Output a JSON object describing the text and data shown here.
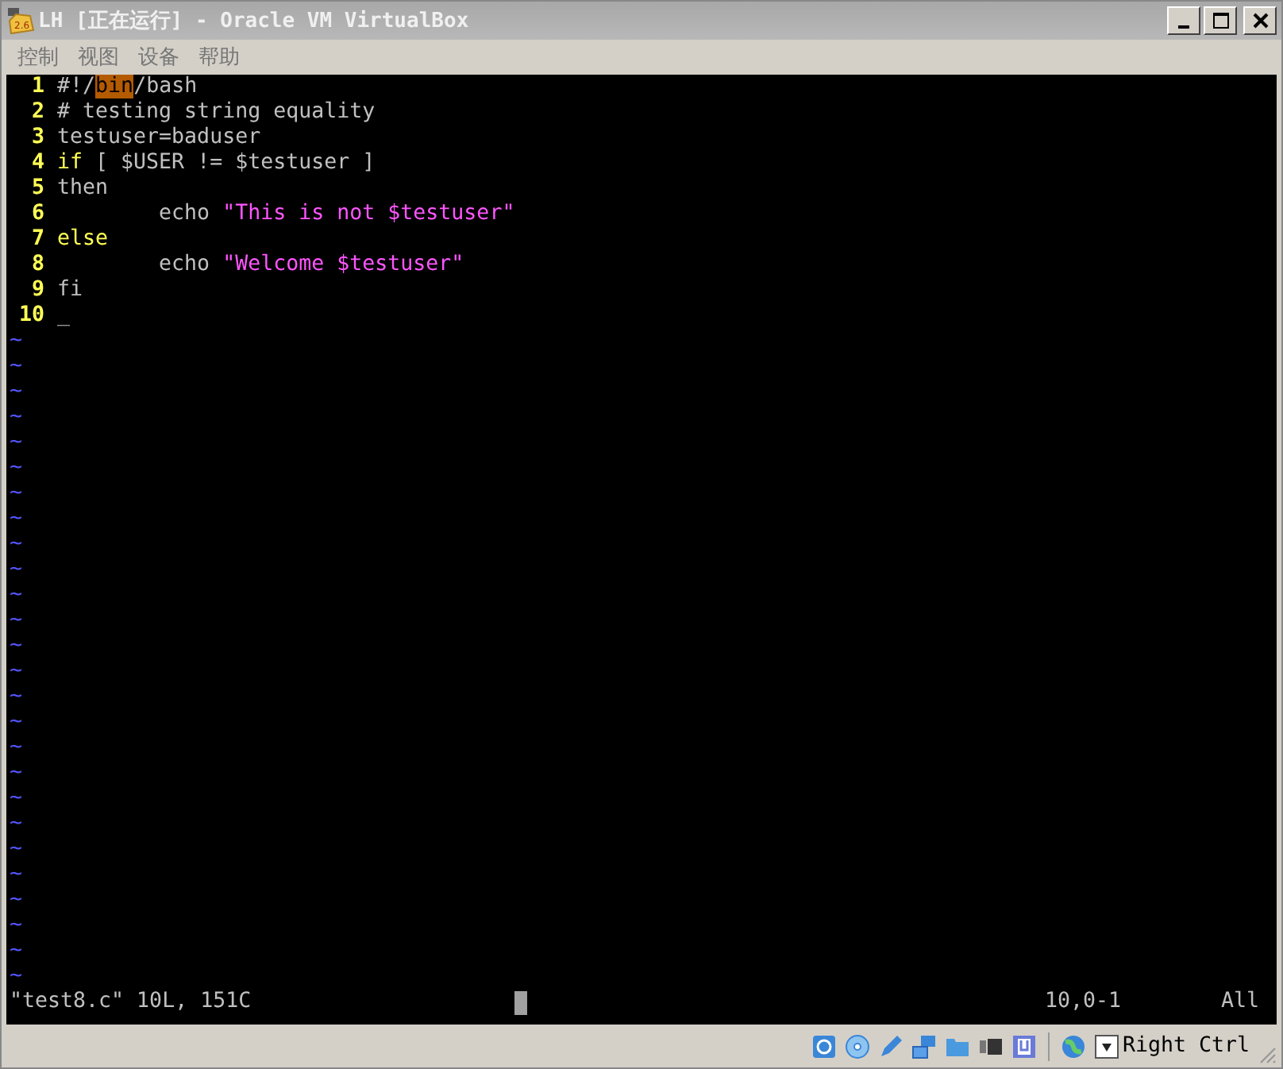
{
  "window": {
    "title": "LH [正在运行] - Oracle VM VirtualBox",
    "icon_label": "2.6"
  },
  "menu": [
    "控制",
    "视图",
    "设备",
    "帮助"
  ],
  "editor": {
    "lines": [
      {
        "number": "1",
        "segments": [
          {
            "text": "#!/",
            "kind": "normal"
          },
          {
            "text": "bin",
            "kind": "highlight"
          },
          {
            "text": "/bash",
            "kind": "normal"
          }
        ]
      },
      {
        "number": "2",
        "segments": [
          {
            "text": "# testing string equality",
            "kind": "normal"
          }
        ]
      },
      {
        "number": "3",
        "segments": [
          {
            "text": "testuser=baduser",
            "kind": "normal"
          }
        ]
      },
      {
        "number": "4",
        "segments": [
          {
            "text": "if",
            "kind": "keyword"
          },
          {
            "text": " [ $USER != $testuser ]",
            "kind": "normal"
          }
        ]
      },
      {
        "number": "5",
        "segments": [
          {
            "text": "then",
            "kind": "normal"
          }
        ]
      },
      {
        "number": "6",
        "segments": [
          {
            "text": "        echo ",
            "kind": "normal"
          },
          {
            "text": "\"This is not $testuser\"",
            "kind": "string"
          }
        ]
      },
      {
        "number": "7",
        "segments": [
          {
            "text": "else",
            "kind": "keyword"
          }
        ]
      },
      {
        "number": "8",
        "segments": [
          {
            "text": "        echo ",
            "kind": "normal"
          },
          {
            "text": "\"Welcome $testuser\"",
            "kind": "string"
          }
        ]
      },
      {
        "number": "9",
        "segments": [
          {
            "text": "fi",
            "kind": "normal"
          }
        ]
      },
      {
        "number": "10",
        "segments": [
          {
            "text": "_",
            "kind": "normal"
          }
        ]
      }
    ],
    "empty_markers": [
      "~",
      "~",
      "~",
      "~",
      "~",
      "~",
      "~",
      "~",
      "~",
      "~",
      "~",
      "~",
      "~",
      "~",
      "~",
      "~",
      "~",
      "~",
      "~",
      "~",
      "~",
      "~",
      "~",
      "~",
      "~",
      "~"
    ],
    "status": {
      "message": "\"test8.c\" 10L, 151C",
      "position": "10,0-1",
      "scroll": "All"
    }
  },
  "status_bar": {
    "host_key": "Right Ctrl"
  }
}
